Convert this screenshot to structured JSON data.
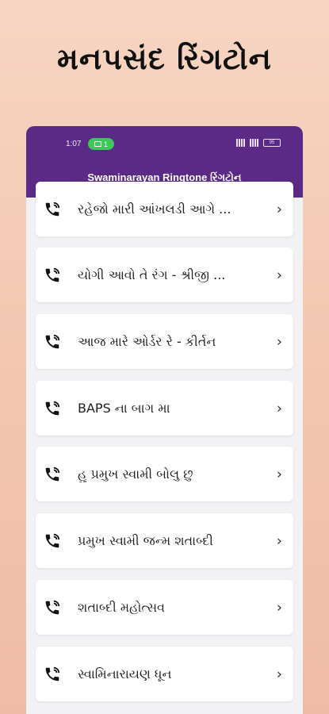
{
  "promo": {
    "title": "મનપસંદ રિંગટોન"
  },
  "status": {
    "time": "1:07",
    "pill_count": "1",
    "battery": "95"
  },
  "app": {
    "title": "Swaminarayan Ringtone રિંગટોન"
  },
  "items": [
    {
      "label": "રહેજો મારી આંખલડી આગે ..."
    },
    {
      "label": "યોગી આવો તે રંગ - શ્રીજી ..."
    },
    {
      "label": "આજ મારે ઓર્ડર રે - કીર્તન"
    },
    {
      "label": "BAPS ના બાગ મા"
    },
    {
      "label": "હુ પ્રમુખ સ્વામી બોલુ છુ"
    },
    {
      "label": "પ્રમુખ સ્વામી જન્મ શતાબ્દી"
    },
    {
      "label": "શતાબ્દી મહોત્સવ"
    },
    {
      "label": "સ્વામિનારાયણ ધૂન"
    }
  ],
  "colors": {
    "appbar": "#5b2a86",
    "background_top": "#f6d5c2",
    "status_pill": "#3cc85a"
  },
  "icons": {
    "item_icon": "phone-ring-icon",
    "item_action": "chevron-right-icon"
  }
}
